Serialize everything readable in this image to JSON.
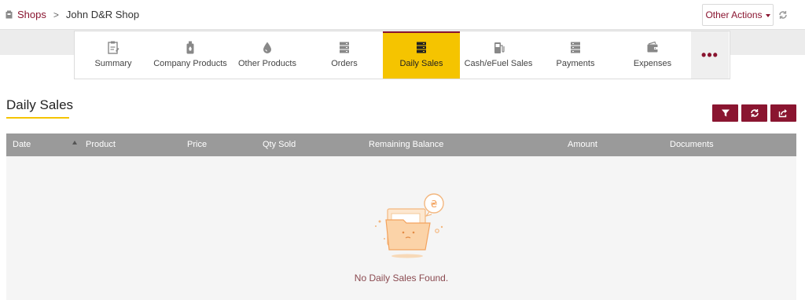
{
  "breadcrumb": {
    "root": "Shops",
    "separator": ">",
    "current": "John D&R Shop"
  },
  "header": {
    "other_actions": "Other Actions"
  },
  "tabs": [
    {
      "label": "Summary",
      "icon": "summary-icon"
    },
    {
      "label": "Company Products",
      "icon": "bottle-icon"
    },
    {
      "label": "Other Products",
      "icon": "drop-icon"
    },
    {
      "label": "Orders",
      "icon": "orders-icon"
    },
    {
      "label": "Daily Sales",
      "icon": "daily-sales-icon",
      "active": true
    },
    {
      "label": "Cash/eFuel Sales",
      "icon": "fuel-pump-icon"
    },
    {
      "label": "Payments",
      "icon": "payments-icon"
    },
    {
      "label": "Expenses",
      "icon": "wallet-icon"
    }
  ],
  "page": {
    "title": "Daily Sales",
    "empty_message": "No Daily Sales Found."
  },
  "table": {
    "columns": [
      "Date",
      "Product",
      "Price",
      "Qty Sold",
      "Remaining Balance",
      "Amount",
      "Documents"
    ]
  },
  "colors": {
    "brand": "#8a1530",
    "accent": "#f5c400",
    "header_gray": "#9a9a9a"
  }
}
